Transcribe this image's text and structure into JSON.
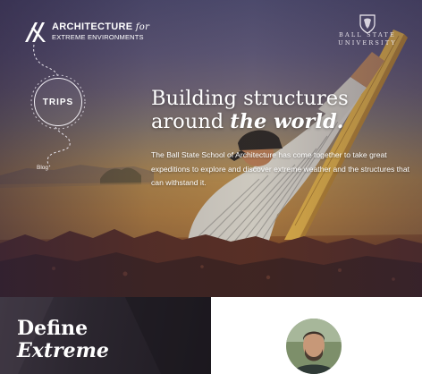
{
  "header": {
    "logo": {
      "line1": "ARCHITECTURE",
      "line1_italic": "for",
      "line2": "EXTREME ENVIRONMENTS"
    },
    "university": {
      "line1": "BALL STATE",
      "line2": "UNIVERSITY"
    }
  },
  "nav": {
    "trips_label": "TRIPS",
    "blog_label": "Blog"
  },
  "hero": {
    "headline_line1": "Building structures",
    "headline_line2_pre": "around ",
    "headline_line2_em": "the world.",
    "intro": "The Ball State School of Architecture has come together to take great expeditions to explore and discover extreme weather and the structures that can withstand it."
  },
  "section": {
    "define_line1": "Define",
    "define_line2": "Extreme"
  },
  "colors": {
    "hero_top": "#4e4c6e",
    "hero_sand": "#b58c4c",
    "hero_earth": "#4c2b22",
    "panel_dark": "#2b262f",
    "panel_light": "#ffffff"
  },
  "icons": [
    "ae-logo-icon",
    "ball-state-crest-icon"
  ]
}
